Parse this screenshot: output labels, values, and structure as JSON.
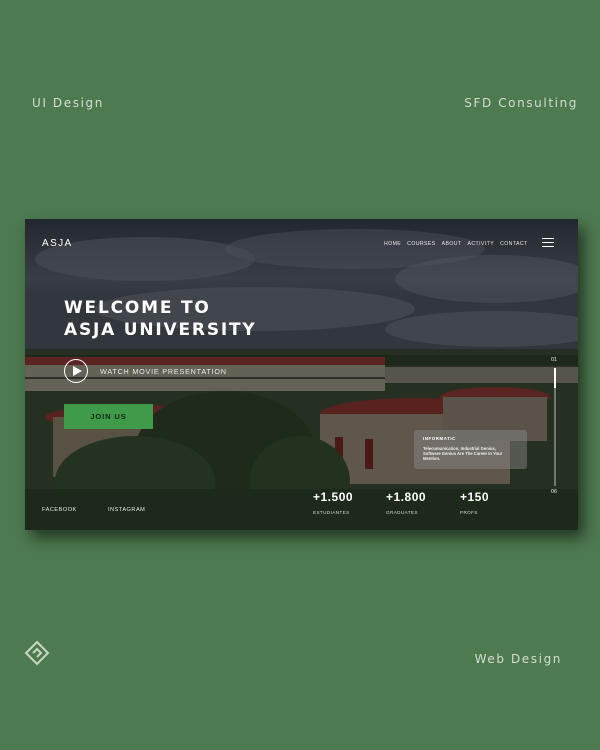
{
  "poster": {
    "top_left": "UI Design",
    "top_right": "SFD Consulting",
    "bottom_right": "Web Design"
  },
  "site": {
    "brand": "ASJA",
    "nav": [
      "HOME",
      "COURSES",
      "ABOUT",
      "ACTIVITY",
      "CONTACT"
    ],
    "hero": {
      "title_line1": "WELCOME TO",
      "title_line2": "ASJA UNIVERSITY",
      "watch_label": "WATCH MOVIE PRESENTATION",
      "cta_label": "JOIN US"
    },
    "slider": {
      "start": "01",
      "end": "06"
    },
    "info_card": {
      "heading": "INFORMATIC",
      "body": "Telecomunication, Industrial Genius, Software Genius Are The Career In Your Mention."
    },
    "stats": [
      {
        "value": "+1.500",
        "label": "ESTUDIANTES"
      },
      {
        "value": "+1.800",
        "label": "GRADUATES"
      },
      {
        "value": "+150",
        "label": "PROFS"
      }
    ],
    "social": [
      "FACEBOOK",
      "INSTAGRAM"
    ]
  },
  "colors": {
    "poster_bg": "#4e7a50",
    "accent": "#3f9a49"
  },
  "icons": [
    "brand-logo-icon",
    "menu-icon",
    "play-icon"
  ]
}
